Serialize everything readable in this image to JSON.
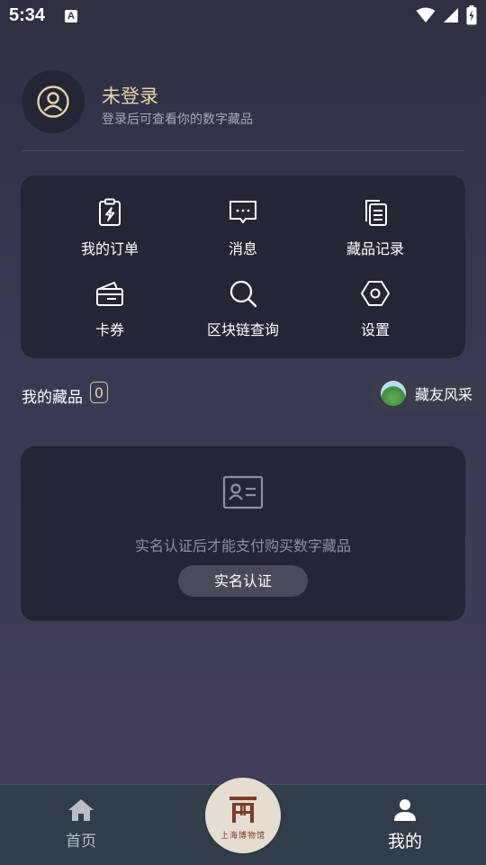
{
  "status_bar": {
    "time": "5:34",
    "notification_icon": "A"
  },
  "profile": {
    "name": "未登录",
    "subtitle": "登录后可查看你的数字藏品"
  },
  "menu": {
    "items": [
      {
        "label": "我的订单",
        "icon": "order-clipboard-icon"
      },
      {
        "label": "消息",
        "icon": "message-bubble-icon"
      },
      {
        "label": "藏品记录",
        "icon": "document-stack-icon"
      },
      {
        "label": "卡券",
        "icon": "coupon-wallet-icon"
      },
      {
        "label": "区块链查询",
        "icon": "search-icon"
      },
      {
        "label": "设置",
        "icon": "settings-hexagon-icon"
      }
    ]
  },
  "collection": {
    "title": "我的藏品",
    "count": "0",
    "friends_label": "藏友风采"
  },
  "verify": {
    "message": "实名认证后才能支付购买数字藏品",
    "button_label": "实名认证"
  },
  "bottom_nav": {
    "home_label": "首页",
    "mine_label": "我的",
    "logo_text": "上海博物馆"
  },
  "colors": {
    "accent_gold": "#e7d3a7",
    "card_bg": "#242535",
    "page_bg_top": "#2f3044",
    "nav_bg": "#313d48"
  }
}
